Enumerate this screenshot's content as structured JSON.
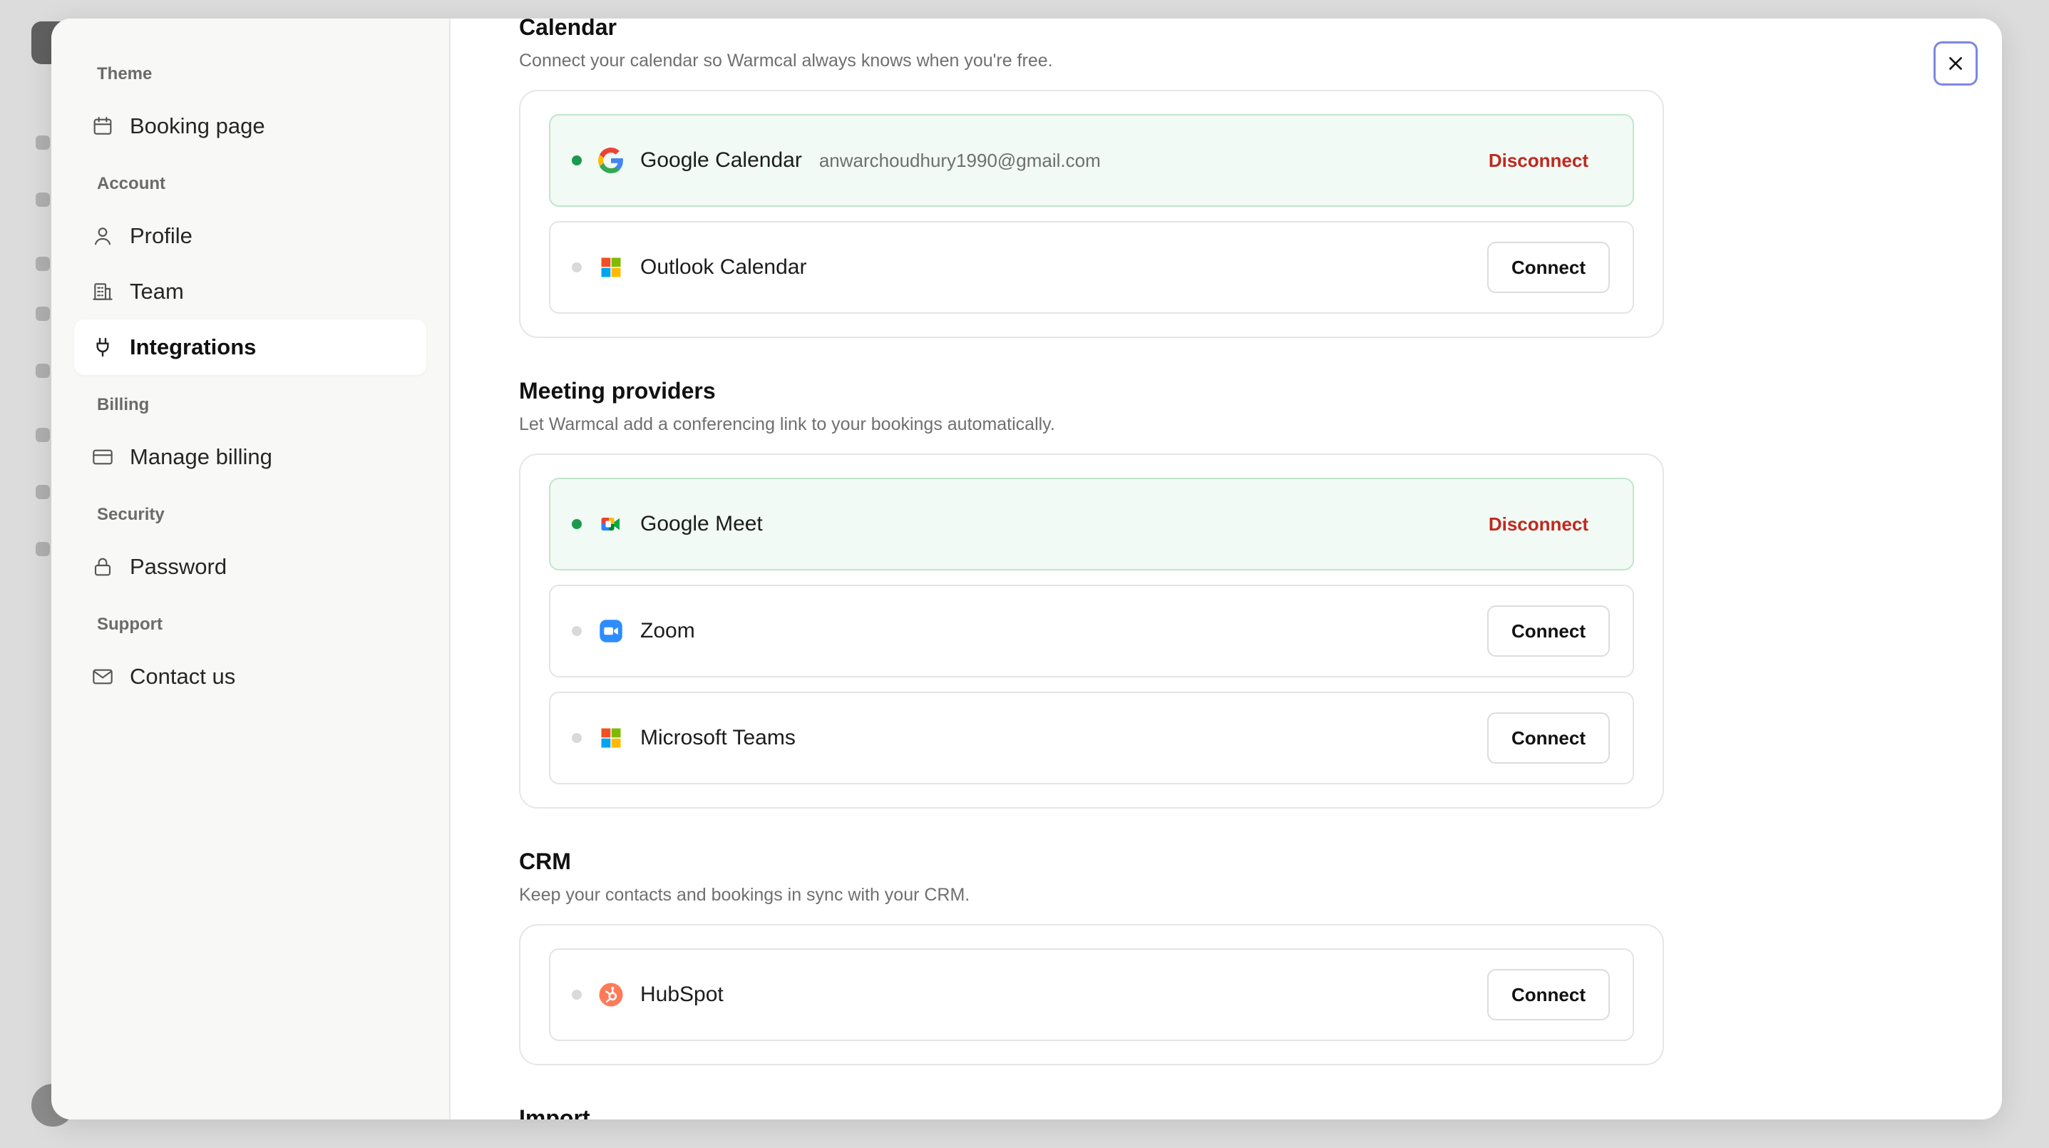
{
  "sidebar": {
    "groups": [
      {
        "label": "Theme",
        "items": [
          {
            "label": "Booking page",
            "icon": "calendar-icon"
          }
        ]
      },
      {
        "label": "Account",
        "items": [
          {
            "label": "Profile",
            "icon": "user-icon"
          },
          {
            "label": "Team",
            "icon": "building-icon"
          },
          {
            "label": "Integrations",
            "icon": "plug-icon",
            "active": true
          }
        ]
      },
      {
        "label": "Billing",
        "items": [
          {
            "label": "Manage billing",
            "icon": "credit-card-icon"
          }
        ]
      },
      {
        "label": "Security",
        "items": [
          {
            "label": "Password",
            "icon": "lock-icon"
          }
        ]
      },
      {
        "label": "Support",
        "items": [
          {
            "label": "Contact us",
            "icon": "mail-icon"
          }
        ]
      }
    ]
  },
  "main": {
    "calendar": {
      "title": "Calendar",
      "desc": "Connect your calendar so Warmcal always knows when you're free.",
      "rows": [
        {
          "name": "Google Calendar",
          "email": "anwarchoudhury1990@gmail.com",
          "action": "Disconnect",
          "connected": true,
          "icon": "google-icon"
        },
        {
          "name": "Outlook Calendar",
          "action": "Connect",
          "connected": false,
          "icon": "microsoft-icon"
        }
      ]
    },
    "meeting": {
      "title": "Meeting providers",
      "desc": "Let Warmcal add a conferencing link to your bookings automatically.",
      "rows": [
        {
          "name": "Google Meet",
          "action": "Disconnect",
          "connected": true,
          "icon": "google-meet-icon"
        },
        {
          "name": "Zoom",
          "action": "Connect",
          "connected": false,
          "icon": "zoom-icon"
        },
        {
          "name": "Microsoft Teams",
          "action": "Connect",
          "connected": false,
          "icon": "microsoft-icon"
        }
      ]
    },
    "crm": {
      "title": "CRM",
      "desc": "Keep your contacts and bookings in sync with your CRM.",
      "rows": [
        {
          "name": "HubSpot",
          "action": "Connect",
          "connected": false,
          "icon": "hubspot-icon"
        }
      ]
    },
    "import": {
      "title": "Import"
    }
  },
  "colors": {
    "connected_dot": "#1c9a4c",
    "disconnect_text": "#c0281f",
    "connected_row_bg": "#f1faf4",
    "close_focus_ring": "#7b88e0"
  }
}
